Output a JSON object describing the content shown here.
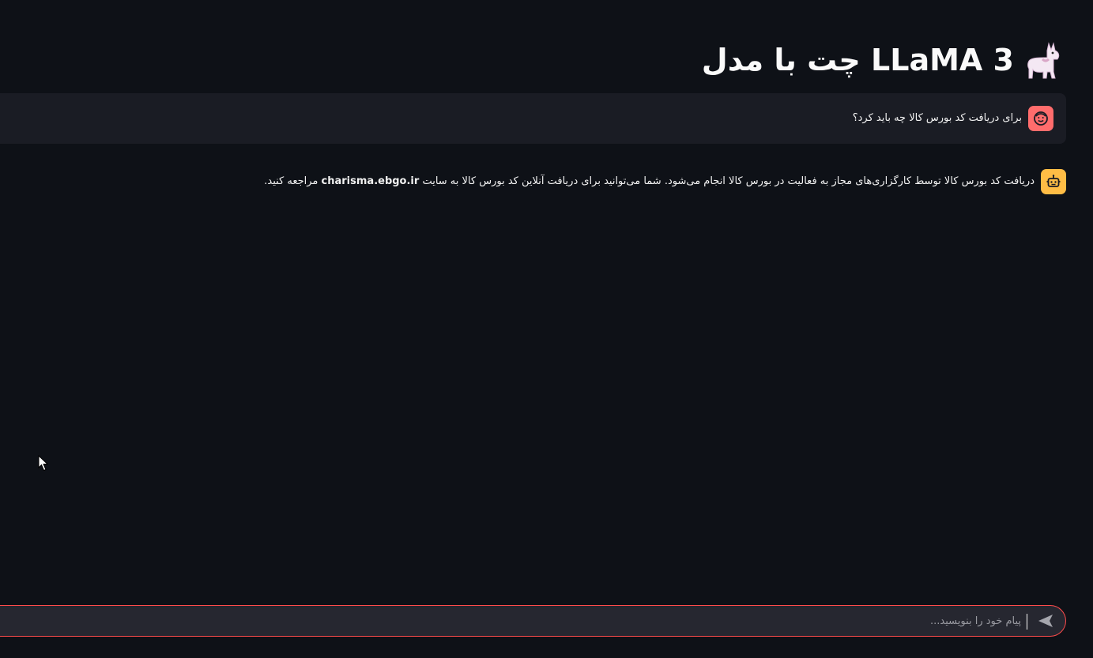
{
  "header": {
    "title": "چت با مدل LLaMA 3",
    "title_icon": "llama-icon"
  },
  "messages": [
    {
      "role": "user",
      "avatar_icon": "face-icon",
      "avatar_color": "#ff6c6c",
      "text": "برای دریافت کد بورس کالا چه باید کرد؟"
    },
    {
      "role": "assistant",
      "avatar_icon": "robot-icon",
      "avatar_color": "#ffbd45",
      "text_before": "دریافت کد بورس کالا توسط کارگزاری‌های مجاز به فعالیت در بورس کالا انجام می‌شود. شما می‌توانید برای دریافت آنلاین کد بورس کالا به سایت",
      "link": "charisma.ebgo.ir",
      "text_after": "مراجعه کنید."
    }
  ],
  "chat_input": {
    "placeholder": "پیام خود را بنویسید...",
    "value": "",
    "send_icon": "send-icon",
    "border_color": "#ff4b4b"
  },
  "colors": {
    "background": "#0e1117",
    "user_bubble": "#1a1c24",
    "input_background": "#262730"
  }
}
